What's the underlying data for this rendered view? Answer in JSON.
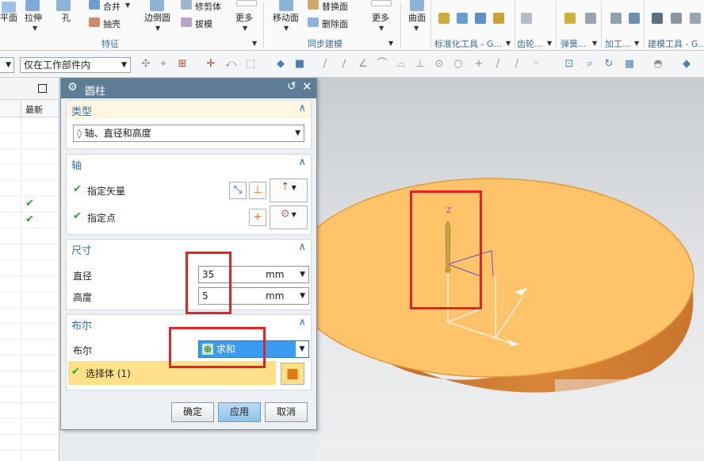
{
  "ribbon": {
    "items": {
      "plane": "平面",
      "extrude": "拉伸",
      "hole": "孔",
      "unite": "合并",
      "shell": "抽壳",
      "edge_blend": "边倒圆",
      "trim_body": "修剪体",
      "draft": "拔模",
      "more1": "更多",
      "move_face": "移动面",
      "replace_face": "替换面",
      "delete_face": "删除面",
      "more2": "更多",
      "surface": "曲面"
    },
    "groups": {
      "feature": "特征",
      "sync_modeling": "同步建模",
      "standard_tools": "标准化工具 - G...",
      "gear": "齿轮...",
      "spring": "弹簧...",
      "machining": "加工...",
      "modeling_tools": "建模工具 - G..."
    }
  },
  "toolbar": {
    "scope_value": "仅在工作部件内"
  },
  "navigator": {
    "column_latest": "最新",
    "rows": [
      false,
      false,
      false,
      false,
      false,
      true,
      true,
      false,
      false,
      false,
      false,
      false,
      false,
      false,
      false,
      false,
      false,
      false,
      false,
      false,
      false,
      false
    ]
  },
  "dialog": {
    "title": "圆柱",
    "type_section": "类型",
    "type_value": "轴、直径和高度",
    "axis_section": "轴",
    "specify_vector": "指定矢量",
    "specify_point": "指定点",
    "dimension_section": "尺寸",
    "diameter_label": "直径",
    "diameter_value": "35",
    "diameter_unit": "mm",
    "height_label": "高度",
    "height_value": "5",
    "height_unit": "mm",
    "boolean_section": "布尔",
    "boolean_label": "布尔",
    "boolean_value": "求和",
    "select_body": "选择体 (1)",
    "ok": "确定",
    "apply": "应用",
    "cancel": "取消"
  },
  "colors": {
    "dialog_title_bar": "#5d7d95",
    "section_label": "#2f6fb0",
    "model_face": "#ffc469",
    "highlight_box": "#e2232a",
    "check_green": "#27a33b",
    "select_row": "#ffe08a"
  }
}
